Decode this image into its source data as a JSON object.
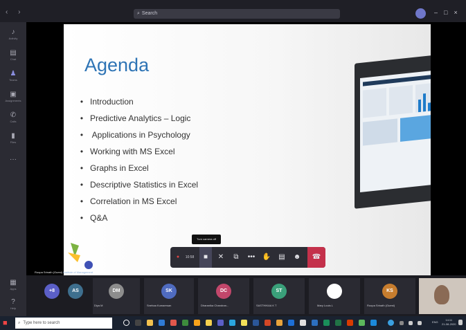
{
  "search": {
    "placeholder": "Search"
  },
  "window_controls": {
    "minimize": "–",
    "maximize": "□",
    "close": "×"
  },
  "rail": [
    {
      "label": "Activity",
      "icon": "bell-icon",
      "glyph": "♪"
    },
    {
      "label": "Chat",
      "icon": "chat-icon",
      "glyph": "▤"
    },
    {
      "label": "Teams",
      "icon": "teams-icon",
      "glyph": "♟"
    },
    {
      "label": "Assignments",
      "icon": "assignments-icon",
      "glyph": "▣"
    },
    {
      "label": "Calls",
      "icon": "phone-icon",
      "glyph": "✆"
    },
    {
      "label": "Files",
      "icon": "file-icon",
      "glyph": "▮"
    },
    {
      "label": "...",
      "icon": "more-icon",
      "glyph": "···"
    },
    {
      "label": "Apps",
      "icon": "apps-icon",
      "glyph": "▦"
    },
    {
      "label": "Help",
      "icon": "help-icon",
      "glyph": "?"
    }
  ],
  "slide": {
    "title": "Agenda",
    "bullet": "•",
    "items": [
      "Introduction",
      "Predictive Analytics – Logic",
      " Applications in Psychology",
      "Working with MS Excel",
      "Graphs in Excel",
      "Descriptive Statistics in Excel",
      "Correlation in MS Excel",
      "Q&A"
    ]
  },
  "presenter": {
    "name": "Roopa Srinath (Guest)",
    "institute": "Institute of Management"
  },
  "call": {
    "timer": "10:58",
    "tooltip": "Turn camera off",
    "controls": [
      "camera",
      "microphone",
      "share",
      "more",
      "raise-hand",
      "chat",
      "participants",
      "leave"
    ]
  },
  "participants": [
    {
      "initials": "+8",
      "name": "",
      "color": "#5b5fc7"
    },
    {
      "initials": "AS",
      "name": "",
      "color": "#3e6f8e"
    },
    {
      "initials": "DM",
      "name": "Diya M",
      "color": "#8d8d8d"
    },
    {
      "initials": "SK",
      "name": "Snehaa Kumaresan",
      "color": "#4f6bbf"
    },
    {
      "initials": "DC",
      "name": "Dharanika Chandran...",
      "color": "#c2476b"
    },
    {
      "initials": "ST",
      "name": "SASTHIKAA K T",
      "color": "#3aa07a"
    },
    {
      "initials": "",
      "name": "Mary Louis L",
      "color": "#ffffff"
    },
    {
      "initials": "KS",
      "name": "Roopa Srinath (Guest)",
      "color": "#c77d2e"
    }
  ],
  "taskbar": {
    "search_placeholder": "Type here to search",
    "lang": "ENG",
    "time": "14:11",
    "date": "21-08-2020"
  }
}
